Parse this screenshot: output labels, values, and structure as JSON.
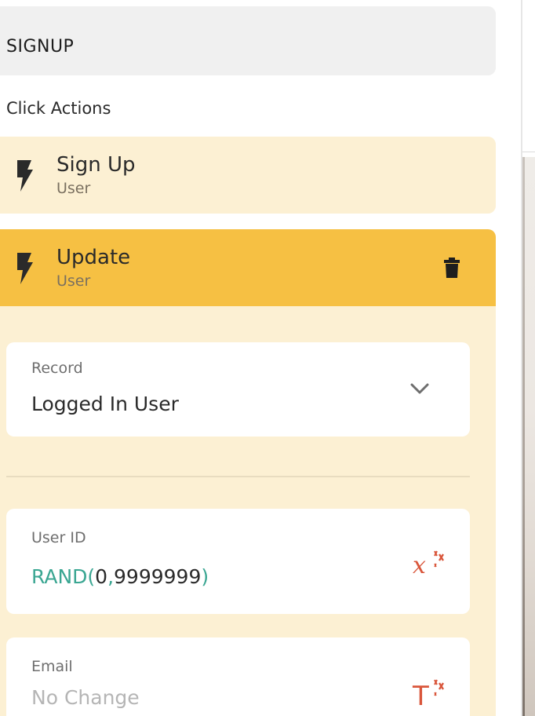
{
  "component": {
    "name": "SIGNUP"
  },
  "click_actions": {
    "label": "Click Actions",
    "items": [
      {
        "title": "Sign Up",
        "subtitle": "User",
        "icon": "lightning-bolt-icon"
      },
      {
        "title": "Update",
        "subtitle": "User",
        "icon": "lightning-bolt-icon",
        "expanded": true
      }
    ]
  },
  "update_form": {
    "record": {
      "label": "Record",
      "value": "Logged In User"
    },
    "user_id": {
      "label": "User ID",
      "formula_fn": "RAND(",
      "arg1": "0",
      "comma": ",",
      "arg2": "9999999",
      "close": ")",
      "icon": "magic-variable-icon"
    },
    "email": {
      "label": "Email",
      "placeholder": "No Change",
      "icon": "magic-text-icon"
    }
  },
  "colors": {
    "accent_selected": "#f6c043",
    "accent_light": "#fcf0d3",
    "formula": "#3aa692",
    "magic_icon": "#d9563b"
  }
}
